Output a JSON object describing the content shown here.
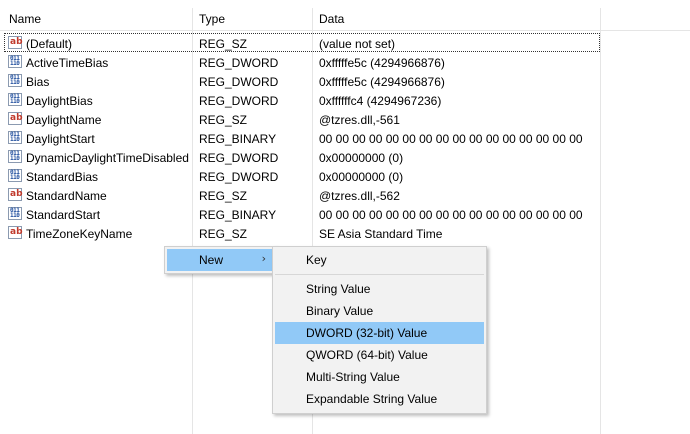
{
  "columns": {
    "name": "Name",
    "type": "Type",
    "data": "Data"
  },
  "rows": [
    {
      "icon": "string-value-icon",
      "name": "(Default)",
      "type": "REG_SZ",
      "data": "(value not set)"
    },
    {
      "icon": "binary-value-icon",
      "name": "ActiveTimeBias",
      "type": "REG_DWORD",
      "data": "0xfffffe5c (4294966876)"
    },
    {
      "icon": "binary-value-icon",
      "name": "Bias",
      "type": "REG_DWORD",
      "data": "0xfffffe5c (4294966876)"
    },
    {
      "icon": "binary-value-icon",
      "name": "DaylightBias",
      "type": "REG_DWORD",
      "data": "0xffffffc4 (4294967236)"
    },
    {
      "icon": "string-value-icon",
      "name": "DaylightName",
      "type": "REG_SZ",
      "data": "@tzres.dll,-561"
    },
    {
      "icon": "binary-value-icon",
      "name": "DaylightStart",
      "type": "REG_BINARY",
      "data": "00 00 00 00 00 00 00 00 00 00 00 00 00 00 00 00"
    },
    {
      "icon": "binary-value-icon",
      "name": "DynamicDaylightTimeDisabled",
      "type": "REG_DWORD",
      "data": "0x00000000 (0)"
    },
    {
      "icon": "binary-value-icon",
      "name": "StandardBias",
      "type": "REG_DWORD",
      "data": "0x00000000 (0)"
    },
    {
      "icon": "string-value-icon",
      "name": "StandardName",
      "type": "REG_SZ",
      "data": "@tzres.dll,-562"
    },
    {
      "icon": "binary-value-icon",
      "name": "StandardStart",
      "type": "REG_BINARY",
      "data": "00 00 00 00 00 00 00 00 00 00 00 00 00 00 00 00"
    },
    {
      "icon": "string-value-icon",
      "name": "TimeZoneKeyName",
      "type": "REG_SZ",
      "data": "SE Asia Standard Time"
    }
  ],
  "context_menu": {
    "new_label": "New",
    "submenu": {
      "key": "Key",
      "string_value": "String Value",
      "binary_value": "Binary Value",
      "dword_value": "DWORD (32-bit) Value",
      "qword_value": "QWORD (64-bit) Value",
      "multi_string_value": "Multi-String Value",
      "expandable_string_value": "Expandable String Value"
    }
  },
  "colors": {
    "highlight": "#91c9f7",
    "menu_bg": "#f2f2f2"
  }
}
